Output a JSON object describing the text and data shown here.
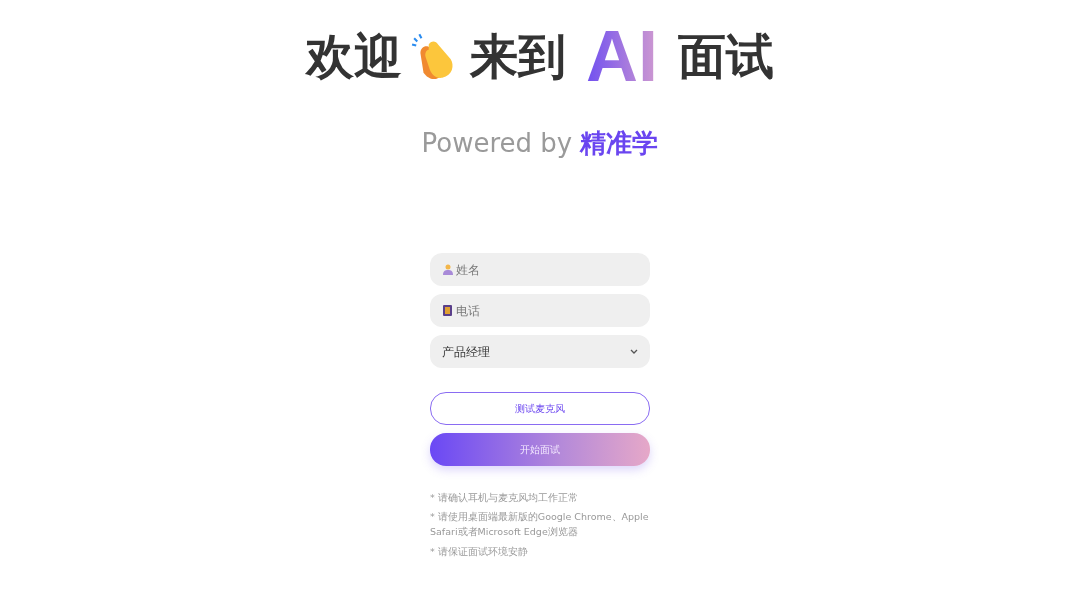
{
  "heading": {
    "part_1": "欢迎",
    "part_2": "来到",
    "highlight": "AI",
    "part_3": "面试"
  },
  "powered": {
    "prefix": "Powered by",
    "brand": "精准学"
  },
  "form": {
    "name_field": {
      "placeholder": "姓名"
    },
    "phone_field": {
      "placeholder": "电话"
    },
    "role_select": {
      "value": "产品经理"
    },
    "buttons": [
      {
        "label": "测试麦克风",
        "kind": "outline"
      },
      {
        "label": "开始面试",
        "kind": "gradient"
      }
    ]
  },
  "notes": [
    "* 请确认耳机与麦克风均工作正常",
    "* 请使用桌面端最新版的Google Chrome、Apple Safari或者Microsoft Edge浏览器",
    "* 请保证面试环境安静"
  ]
}
